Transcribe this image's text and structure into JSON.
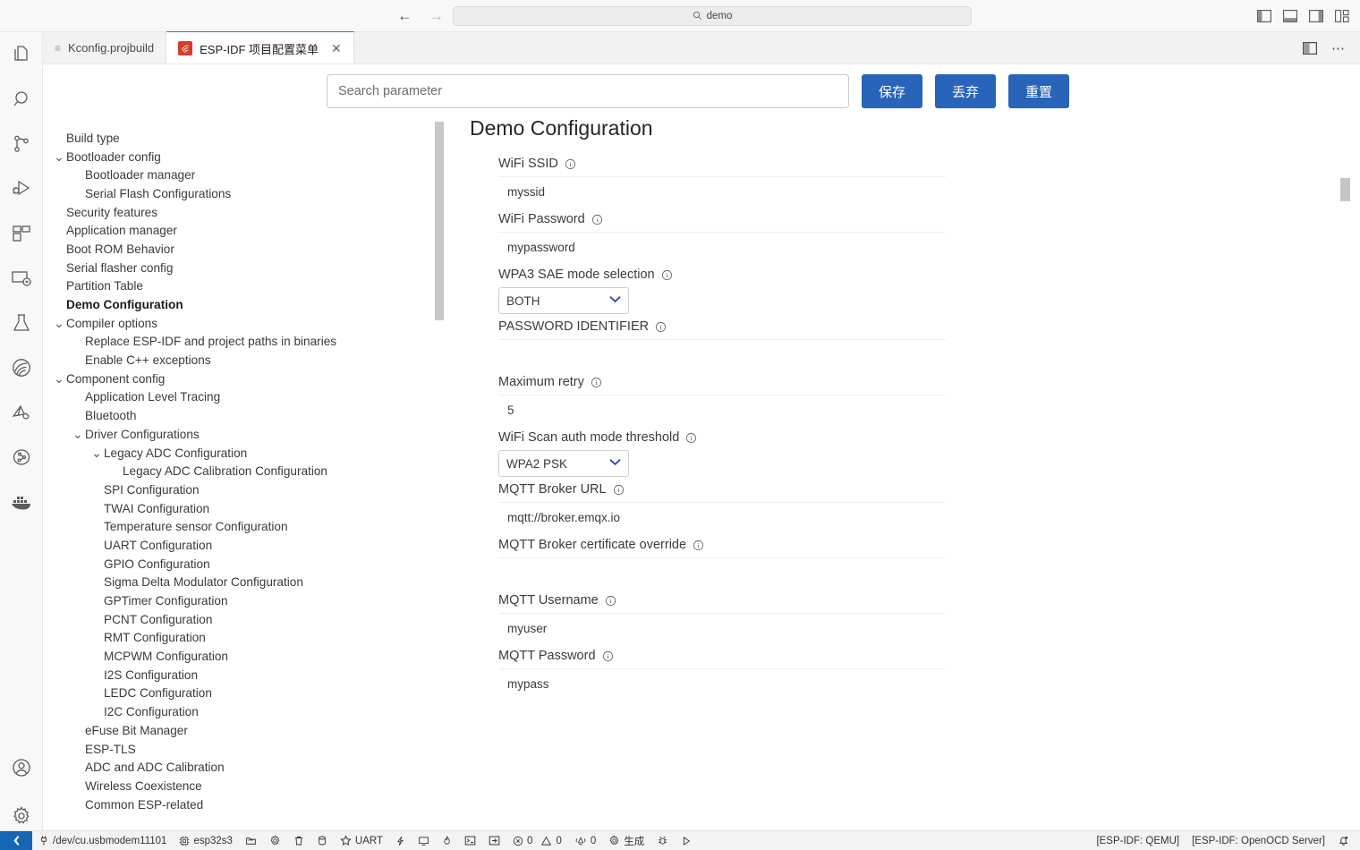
{
  "titlebar": {
    "back_icon": "arrow-left-icon",
    "forward_icon": "arrow-right-icon",
    "command_center_text": "demo",
    "layout_icons": [
      "toggle-primary-sidebar-icon",
      "toggle-panel-icon",
      "toggle-secondary-sidebar-icon",
      "customize-layout-icon"
    ]
  },
  "activitybar": {
    "items": [
      {
        "name": "explorer",
        "icon": "files-icon"
      },
      {
        "name": "search",
        "icon": "search-icon"
      },
      {
        "name": "source-control",
        "icon": "source-control-icon"
      },
      {
        "name": "run-and-debug",
        "icon": "run-debug-icon"
      },
      {
        "name": "extensions",
        "icon": "extensions-icon"
      },
      {
        "name": "remote-explorer",
        "icon": "remote-explorer-icon"
      },
      {
        "name": "testing",
        "icon": "beaker-icon"
      },
      {
        "name": "espressif",
        "icon": "espressif-icon"
      },
      {
        "name": "esp-idf-tools",
        "icon": "idf-tools-icon"
      },
      {
        "name": "circuit",
        "icon": "circuit-icon"
      },
      {
        "name": "docker",
        "icon": "docker-icon"
      }
    ],
    "bottom_items": [
      {
        "name": "accounts",
        "icon": "account-icon"
      },
      {
        "name": "settings",
        "icon": "gear-icon"
      }
    ]
  },
  "tabs": [
    {
      "label": "Kconfig.projbuild",
      "icon": "lines-icon",
      "active": false,
      "closable": false
    },
    {
      "label": "ESP-IDF 项目配置菜单",
      "icon": "espressif-icon",
      "active": true,
      "closable": true
    }
  ],
  "tabbar_actions": [
    {
      "name": "split-editor",
      "icon": "split-editor-icon"
    },
    {
      "name": "more-actions",
      "icon": "ellipsis-icon"
    }
  ],
  "toolbar": {
    "search_placeholder": "Search parameter",
    "search_value": "",
    "save_label": "保存",
    "discard_label": "丢弃",
    "reset_label": "重置",
    "accent_color": "#2864ba"
  },
  "tree": {
    "items": [
      {
        "label": "Build type",
        "indent": 0,
        "chevron": "",
        "selected": false
      },
      {
        "label": "Bootloader config",
        "indent": 0,
        "chevron": "expanded",
        "selected": false
      },
      {
        "label": "Bootloader manager",
        "indent": 1,
        "chevron": "",
        "selected": false
      },
      {
        "label": "Serial Flash Configurations",
        "indent": 1,
        "chevron": "",
        "selected": false
      },
      {
        "label": "Security features",
        "indent": 0,
        "chevron": "",
        "selected": false
      },
      {
        "label": "Application manager",
        "indent": 0,
        "chevron": "",
        "selected": false
      },
      {
        "label": "Boot ROM Behavior",
        "indent": 0,
        "chevron": "",
        "selected": false
      },
      {
        "label": "Serial flasher config",
        "indent": 0,
        "chevron": "",
        "selected": false
      },
      {
        "label": "Partition Table",
        "indent": 0,
        "chevron": "",
        "selected": false
      },
      {
        "label": "Demo Configuration",
        "indent": 0,
        "chevron": "",
        "selected": true
      },
      {
        "label": "Compiler options",
        "indent": 0,
        "chevron": "expanded",
        "selected": false
      },
      {
        "label": "Replace ESP-IDF and project paths in binaries",
        "indent": 1,
        "chevron": "",
        "selected": false
      },
      {
        "label": "Enable C++ exceptions",
        "indent": 1,
        "chevron": "",
        "selected": false
      },
      {
        "label": "Component config",
        "indent": 0,
        "chevron": "expanded",
        "selected": false
      },
      {
        "label": "Application Level Tracing",
        "indent": 1,
        "chevron": "",
        "selected": false
      },
      {
        "label": "Bluetooth",
        "indent": 1,
        "chevron": "",
        "selected": false
      },
      {
        "label": "Driver Configurations",
        "indent": 1,
        "chevron": "expanded",
        "selected": false
      },
      {
        "label": "Legacy ADC Configuration",
        "indent": 2,
        "chevron": "expanded",
        "selected": false
      },
      {
        "label": "Legacy ADC Calibration Configuration",
        "indent": 3,
        "chevron": "",
        "selected": false
      },
      {
        "label": "SPI Configuration",
        "indent": 2,
        "chevron": "",
        "selected": false
      },
      {
        "label": "TWAI Configuration",
        "indent": 2,
        "chevron": "",
        "selected": false
      },
      {
        "label": "Temperature sensor Configuration",
        "indent": 2,
        "chevron": "",
        "selected": false
      },
      {
        "label": "UART Configuration",
        "indent": 2,
        "chevron": "",
        "selected": false
      },
      {
        "label": "GPIO Configuration",
        "indent": 2,
        "chevron": "",
        "selected": false
      },
      {
        "label": "Sigma Delta Modulator Configuration",
        "indent": 2,
        "chevron": "",
        "selected": false
      },
      {
        "label": "GPTimer Configuration",
        "indent": 2,
        "chevron": "",
        "selected": false
      },
      {
        "label": "PCNT Configuration",
        "indent": 2,
        "chevron": "",
        "selected": false
      },
      {
        "label": "RMT Configuration",
        "indent": 2,
        "chevron": "",
        "selected": false
      },
      {
        "label": "MCPWM Configuration",
        "indent": 2,
        "chevron": "",
        "selected": false
      },
      {
        "label": "I2S Configuration",
        "indent": 2,
        "chevron": "",
        "selected": false
      },
      {
        "label": "LEDC Configuration",
        "indent": 2,
        "chevron": "",
        "selected": false
      },
      {
        "label": "I2C Configuration",
        "indent": 2,
        "chevron": "",
        "selected": false
      },
      {
        "label": "eFuse Bit Manager",
        "indent": 1,
        "chevron": "",
        "selected": false
      },
      {
        "label": "ESP-TLS",
        "indent": 1,
        "chevron": "",
        "selected": false
      },
      {
        "label": "ADC and ADC Calibration",
        "indent": 1,
        "chevron": "",
        "selected": false
      },
      {
        "label": "Wireless Coexistence",
        "indent": 1,
        "chevron": "",
        "selected": false
      },
      {
        "label": "Common ESP-related",
        "indent": 1,
        "chevron": "",
        "selected": false
      }
    ]
  },
  "form": {
    "title": "Demo Configuration",
    "fields": [
      {
        "label": "WiFi SSID",
        "type": "text",
        "value": "myssid",
        "info": true
      },
      {
        "label": "WiFi Password",
        "type": "text",
        "value": "mypassword",
        "info": true
      },
      {
        "label": "WPA3 SAE mode selection",
        "type": "select",
        "value": "BOTH",
        "info": true
      },
      {
        "label": "PASSWORD IDENTIFIER",
        "type": "text",
        "value": "",
        "info": true
      },
      {
        "label": "Maximum retry",
        "type": "text",
        "value": "5",
        "info": true
      },
      {
        "label": "WiFi Scan auth mode threshold",
        "type": "select",
        "value": "WPA2 PSK",
        "info": true
      },
      {
        "label": "MQTT Broker URL",
        "type": "text",
        "value": "mqtt://broker.emqx.io",
        "info": true
      },
      {
        "label": "MQTT Broker certificate override",
        "type": "text",
        "value": "",
        "info": true
      },
      {
        "label": "MQTT Username",
        "type": "text",
        "value": "myuser",
        "info": true
      },
      {
        "label": "MQTT Password",
        "type": "text",
        "value": "mypass",
        "info": true
      }
    ]
  },
  "statusbar": {
    "remote_icon": "remote-window-icon",
    "left_items": [
      {
        "name": "serial-port",
        "icon": "plug-icon",
        "label": "/dev/cu.usbmodem11101"
      },
      {
        "name": "target-chip",
        "icon": "chip-icon",
        "label": "esp32s3"
      },
      {
        "name": "open-folder",
        "icon": "folder-icon",
        "label": ""
      },
      {
        "name": "menuconfig",
        "icon": "gear-icon",
        "label": ""
      },
      {
        "name": "full-clean",
        "icon": "trash-icon",
        "label": ""
      },
      {
        "name": "flash-device",
        "icon": "database-icon",
        "label": ""
      },
      {
        "name": "flash-method",
        "icon": "star-icon",
        "label": "UART"
      },
      {
        "name": "build-flash-monitor",
        "icon": "zap-icon",
        "label": ""
      },
      {
        "name": "monitor-device",
        "icon": "monitor-icon",
        "label": ""
      },
      {
        "name": "idf-debug",
        "icon": "flame-icon",
        "label": ""
      },
      {
        "name": "open-terminal",
        "icon": "terminal-icon",
        "label": ""
      },
      {
        "name": "idf-qemu-monitor",
        "icon": "export-icon",
        "label": ""
      }
    ],
    "problems": {
      "errors_icon": "error-icon",
      "errors": "0",
      "warnings_icon": "warning-icon",
      "warnings": "0"
    },
    "radar": {
      "icon": "radar-icon",
      "count": "0"
    },
    "build": {
      "icon": "gear-icon",
      "label": "生成"
    },
    "debug_icon": "bug-icon",
    "run_icon": "play-icon",
    "right_items": [
      {
        "name": "esp-idf-qemu",
        "label": "[ESP-IDF: QEMU]"
      },
      {
        "name": "esp-idf-openocd-server",
        "label": "[ESP-IDF: OpenOCD Server]"
      }
    ],
    "bell_icon": "bell-dot-icon"
  }
}
